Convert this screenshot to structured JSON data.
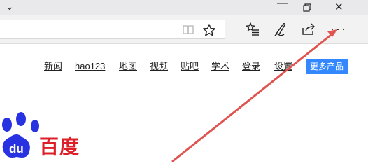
{
  "titlebar": {
    "tab_chevron_icon": "chevron-down-icon",
    "minimize_icon": "minimize-icon",
    "restore_icon": "restore-icon",
    "close_icon": "close-icon"
  },
  "toolbar": {
    "reading_view_icon": "reading-view-icon",
    "favorite_icon": "star-icon",
    "hub_icon": "hub-icon",
    "notes_icon": "pen-icon",
    "share_icon": "share-icon",
    "more_icon": "more-icon",
    "more_label": "···"
  },
  "nav": {
    "links": [
      "新闻",
      "hao123",
      "地图",
      "视频",
      "贴吧",
      "学术",
      "登录",
      "设置"
    ],
    "more_products": "更多产品"
  },
  "logo": {
    "text": "百度",
    "color": "#de1f2a",
    "paw_color": "#2932e1"
  },
  "colors": {
    "arrow": "#e0534f",
    "button": "#3388ff"
  }
}
